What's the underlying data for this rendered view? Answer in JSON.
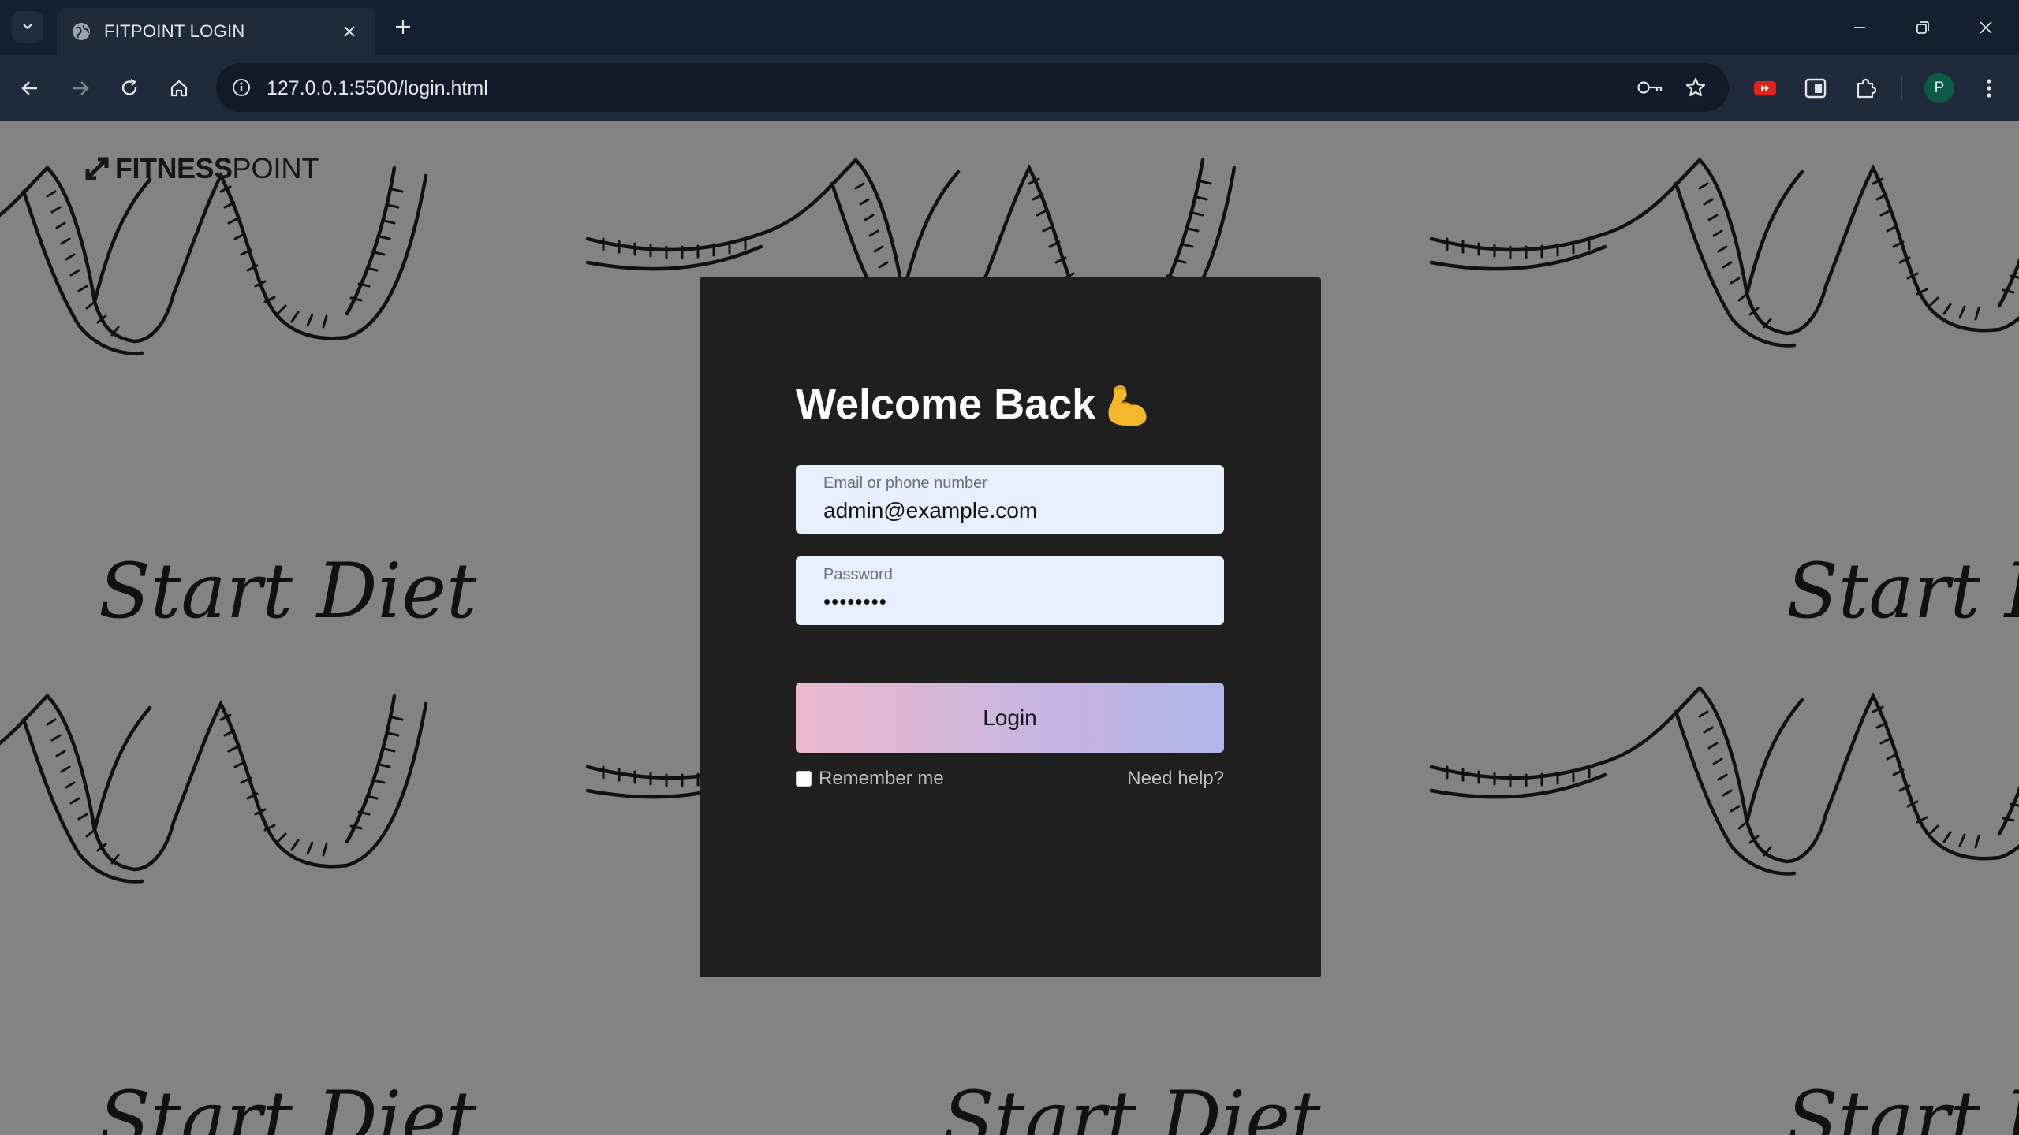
{
  "browser": {
    "tab_title": "FITPOINT LOGIN",
    "url": "127.0.0.1:5500/login.html",
    "profile_initial": "P",
    "icons": [
      "chevron-down-icon",
      "globe-icon",
      "close-icon",
      "plus-icon",
      "minimize-icon",
      "restore-icon",
      "close-window-icon",
      "back-arrow-icon",
      "forward-arrow-icon",
      "reload-icon",
      "home-icon",
      "info-icon",
      "key-icon",
      "star-icon",
      "youtube-extension-icon",
      "sidebar-icon",
      "puzzle-icon",
      "kebab-menu-icon"
    ]
  },
  "page": {
    "brand": {
      "bold": "FITNESS",
      "thin": "POINT"
    },
    "background_text": "Start Diet",
    "title": "Welcome Back",
    "email_field": {
      "label": "Email or phone number",
      "value": "admin@example.com"
    },
    "password_field": {
      "label": "Password",
      "value": "••••••••"
    },
    "login_button": "Login",
    "remember_me": "Remember me",
    "need_help": "Need help?"
  },
  "colors": {
    "page_background": "#838383",
    "card_background": "#1f1f1f",
    "input_background": "#e8effd",
    "button_gradient_start": "#ebb8cb",
    "button_gradient_end": "#b3b6ea",
    "browser_frame": "#12202f"
  }
}
